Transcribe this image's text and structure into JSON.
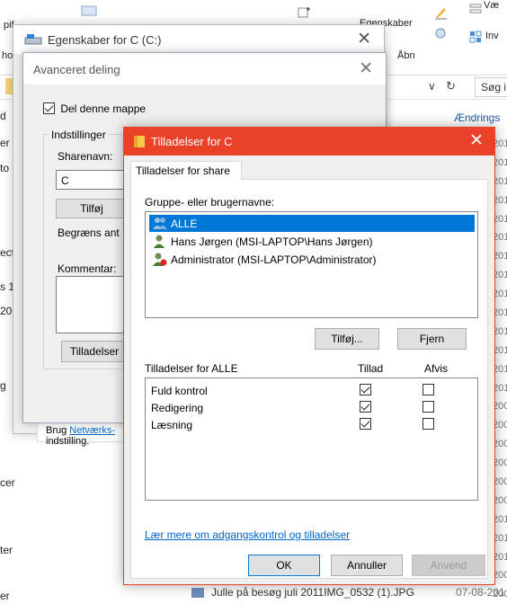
{
  "explorer": {
    "ribbon_left_top": "pif",
    "ribbon_left_mid": "ho",
    "ribbon_egenskaber": "Egenskaber",
    "ribbon_aabn": "Åbn",
    "ribbon_vae": "Væ",
    "ribbon_inv": "Inv",
    "search_placeholder": "Søg i",
    "column_header": "Ændrings",
    "dates": [
      "201",
      "201",
      "201",
      "201",
      "201",
      "201",
      "201",
      "201",
      "201",
      "201",
      "201",
      "201",
      "201",
      "201",
      "200",
      "200",
      "200",
      "200",
      "200",
      "200",
      "201",
      "201",
      "201",
      "200",
      "200"
    ],
    "left_fragments": [
      "d",
      "er",
      "to",
      "ect",
      "s 1",
      "20",
      "g",
      "cer",
      "ter",
      "er"
    ],
    "bottom_file": "Julle på besøg juli 2011IMG_0532 (1).JPG",
    "bottom_date": "07-08-201"
  },
  "properties": {
    "title": "Egenskaber for C (C:)",
    "help_prefix": "Brug ",
    "help_link": "Netværks-",
    "help_suffix": "indstilling."
  },
  "advanced": {
    "title": "Avanceret deling",
    "share_checkbox_label": "Del denne mappe",
    "settings_group": "Indstillinger",
    "sharename_label": "Sharenavn:",
    "sharename_value": "C",
    "add_button": "Tilføj",
    "limit_label": "Begræns ant",
    "comment_label": "Kommentar:",
    "permissions_button": "Tilladelser"
  },
  "permissions": {
    "title": "Tilladelser for C",
    "tab": "Tilladelser for share",
    "group_label": "Gruppe- eller brugernavne:",
    "users": [
      {
        "name": "ALLE",
        "selected": true
      },
      {
        "name": "Hans Jørgen (MSI-LAPTOP\\Hans Jørgen)",
        "selected": false
      },
      {
        "name": "Administrator (MSI-LAPTOP\\Administrator)",
        "selected": false
      }
    ],
    "add_button": "Tilføj...",
    "remove_button": "Fjern",
    "perm_header": "Tilladelser for ALLE",
    "allow_header": "Tillad",
    "deny_header": "Afvis",
    "perms": [
      {
        "name": "Fuld kontrol",
        "allow": true,
        "deny": false
      },
      {
        "name": "Redigering",
        "allow": true,
        "deny": false
      },
      {
        "name": "Læsning",
        "allow": true,
        "deny": false
      }
    ],
    "learn_link": "Lær mere om adgangskontrol og tilladelser",
    "ok_button": "OK",
    "cancel_button": "Annuller",
    "apply_button": "Anvend"
  },
  "colors": {
    "accent_red": "#ea4129",
    "selection_blue": "#0078d7"
  }
}
